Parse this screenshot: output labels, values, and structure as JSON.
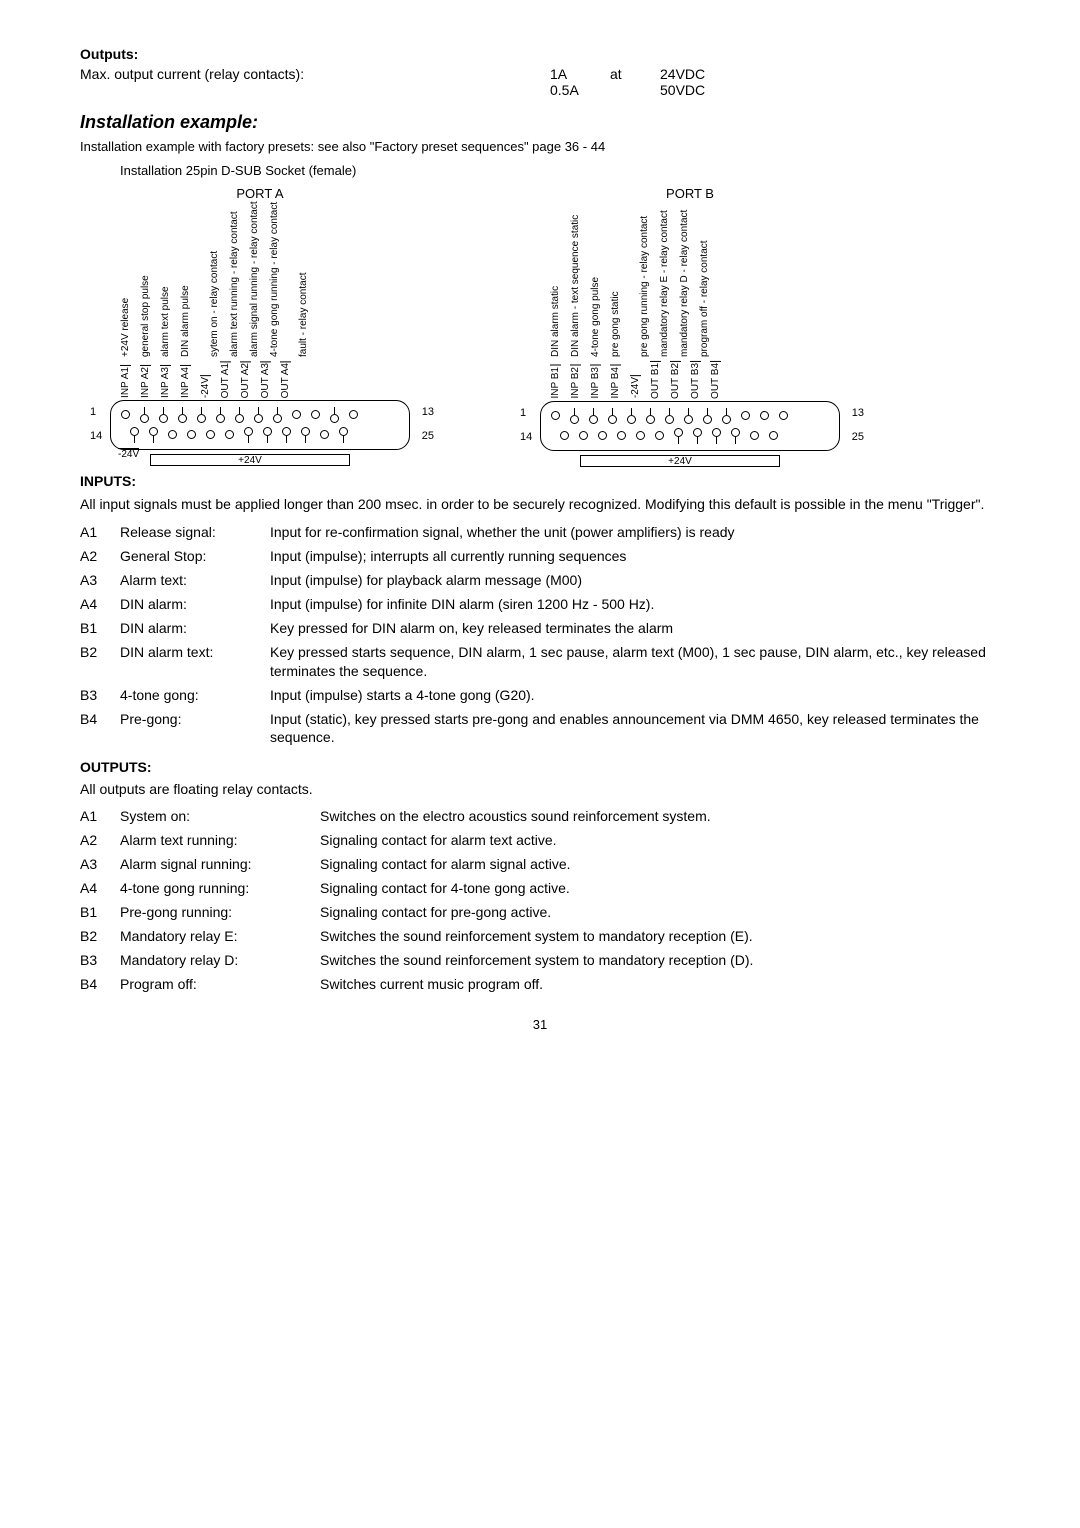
{
  "s_outputs_head": "Outputs:",
  "spec": {
    "label": "Max. output current (relay contacts):",
    "r1a": "1A",
    "r1b": "at",
    "r1c": "24VDC",
    "r2a": "0.5A",
    "r2c": "50VDC"
  },
  "inst_head": "Installation example:",
  "inst_line": "Installation example with factory presets: see also \"Factory preset sequences\" page 36 - 44",
  "inst_caption": "Installation   25pin D-SUB Socket (female)",
  "portA_title": "PORT A",
  "portB_title": "PORT B",
  "busbar": "+24V",
  "portA": {
    "labels": [
      "+24V  release",
      "general stop pulse",
      "alarm text pulse",
      "DIN alarm pulse",
      "",
      "sytem on  -  relay contact",
      "alarm text running  -  relay contact",
      "alarm signal running  -  relay contact",
      "4-tone gong running  -  relay contact",
      "",
      "fault  -  relay contact"
    ],
    "tags": [
      "INP A1",
      "INP A2",
      "INP A3",
      "INP A4",
      "-24V",
      "OUT A1",
      "OUT A2",
      "OUT A3",
      "OUT A4",
      "",
      "",
      ""
    ],
    "bottomtag": "-24V"
  },
  "portB": {
    "labels": [
      "DIN alarm static",
      "DIN alarm - text sequence static",
      "4-tone gong pulse",
      "pre gong static",
      "",
      "pre gong running  -  relay contact",
      "mandatory relay E  -  relay contact",
      "mandatory relay D  -  relay contact",
      "program off  -  relay contact"
    ],
    "tags": [
      "INP B1",
      "INP B2",
      "INP B3",
      "INP B4",
      "-24V",
      "OUT B1",
      "OUT B2",
      "OUT B3",
      "OUT B4"
    ]
  },
  "pins": {
    "n1": "1",
    "n13": "13",
    "n14": "14",
    "n25": "25"
  },
  "inputs_head": "INPUTS:",
  "inputs_intro": "All input signals must be applied longer than 200 msec. in order to be securely recognized. Modifying this default is possible in the menu \"Trigger\".",
  "in": [
    {
      "c": "A1",
      "l": "Release signal:",
      "d": "Input for re-confirmation signal, whether the unit (power amplifiers) is ready"
    },
    {
      "c": "A2",
      "l": "General Stop:",
      "d": "Input (impulse); interrupts all currently running sequences"
    },
    {
      "c": "A3",
      "l": "Alarm text:",
      "d": "Input (impulse) for playback alarm message (M00)"
    },
    {
      "c": "A4",
      "l": "DIN alarm:",
      "d": "Input (impulse) for infinite DIN alarm (siren 1200 Hz - 500 Hz)."
    },
    {
      "c": "B1",
      "l": "DIN alarm:",
      "d": "Key pressed for DIN alarm on, key released terminates the alarm"
    },
    {
      "c": "B2",
      "l": "DIN alarm text:",
      "d": "Key pressed starts sequence, DIN alarm, 1 sec pause, alarm text (M00), 1 sec pause, DIN alarm, etc., key released terminates the sequence."
    },
    {
      "c": "B3",
      "l": "4-tone gong:",
      "d": "Input (impulse) starts a 4-tone gong (G20)."
    },
    {
      "c": "B4",
      "l": "Pre-gong:",
      "d": "Input (static), key pressed starts pre-gong and enables announcement via DMM 4650, key released terminates the sequence."
    }
  ],
  "outputs_head": "OUTPUTS:",
  "outputs_intro": "All outputs are floating relay contacts.",
  "out": [
    {
      "c": "A1",
      "l": "System on:",
      "d": "Switches on the electro acoustics sound reinforcement system."
    },
    {
      "c": "A2",
      "l": "Alarm text running:",
      "d": "Signaling contact for alarm text active."
    },
    {
      "c": "A3",
      "l": "Alarm signal running:",
      "d": "Signaling contact for alarm signal active."
    },
    {
      "c": "A4",
      "l": "4-tone gong running:",
      "d": "Signaling contact for 4-tone gong active."
    },
    {
      "c": "B1",
      "l": "Pre-gong running:",
      "d": "Signaling contact for pre-gong active."
    },
    {
      "c": "B2",
      "l": "Mandatory relay E:",
      "d": "Switches the sound reinforcement system to mandatory reception (E)."
    },
    {
      "c": "B3",
      "l": "Mandatory relay D:",
      "d": "Switches the sound reinforcement system to mandatory reception (D)."
    },
    {
      "c": "B4",
      "l": "Program off:",
      "d": "Switches current music program off."
    }
  ],
  "page": "31"
}
